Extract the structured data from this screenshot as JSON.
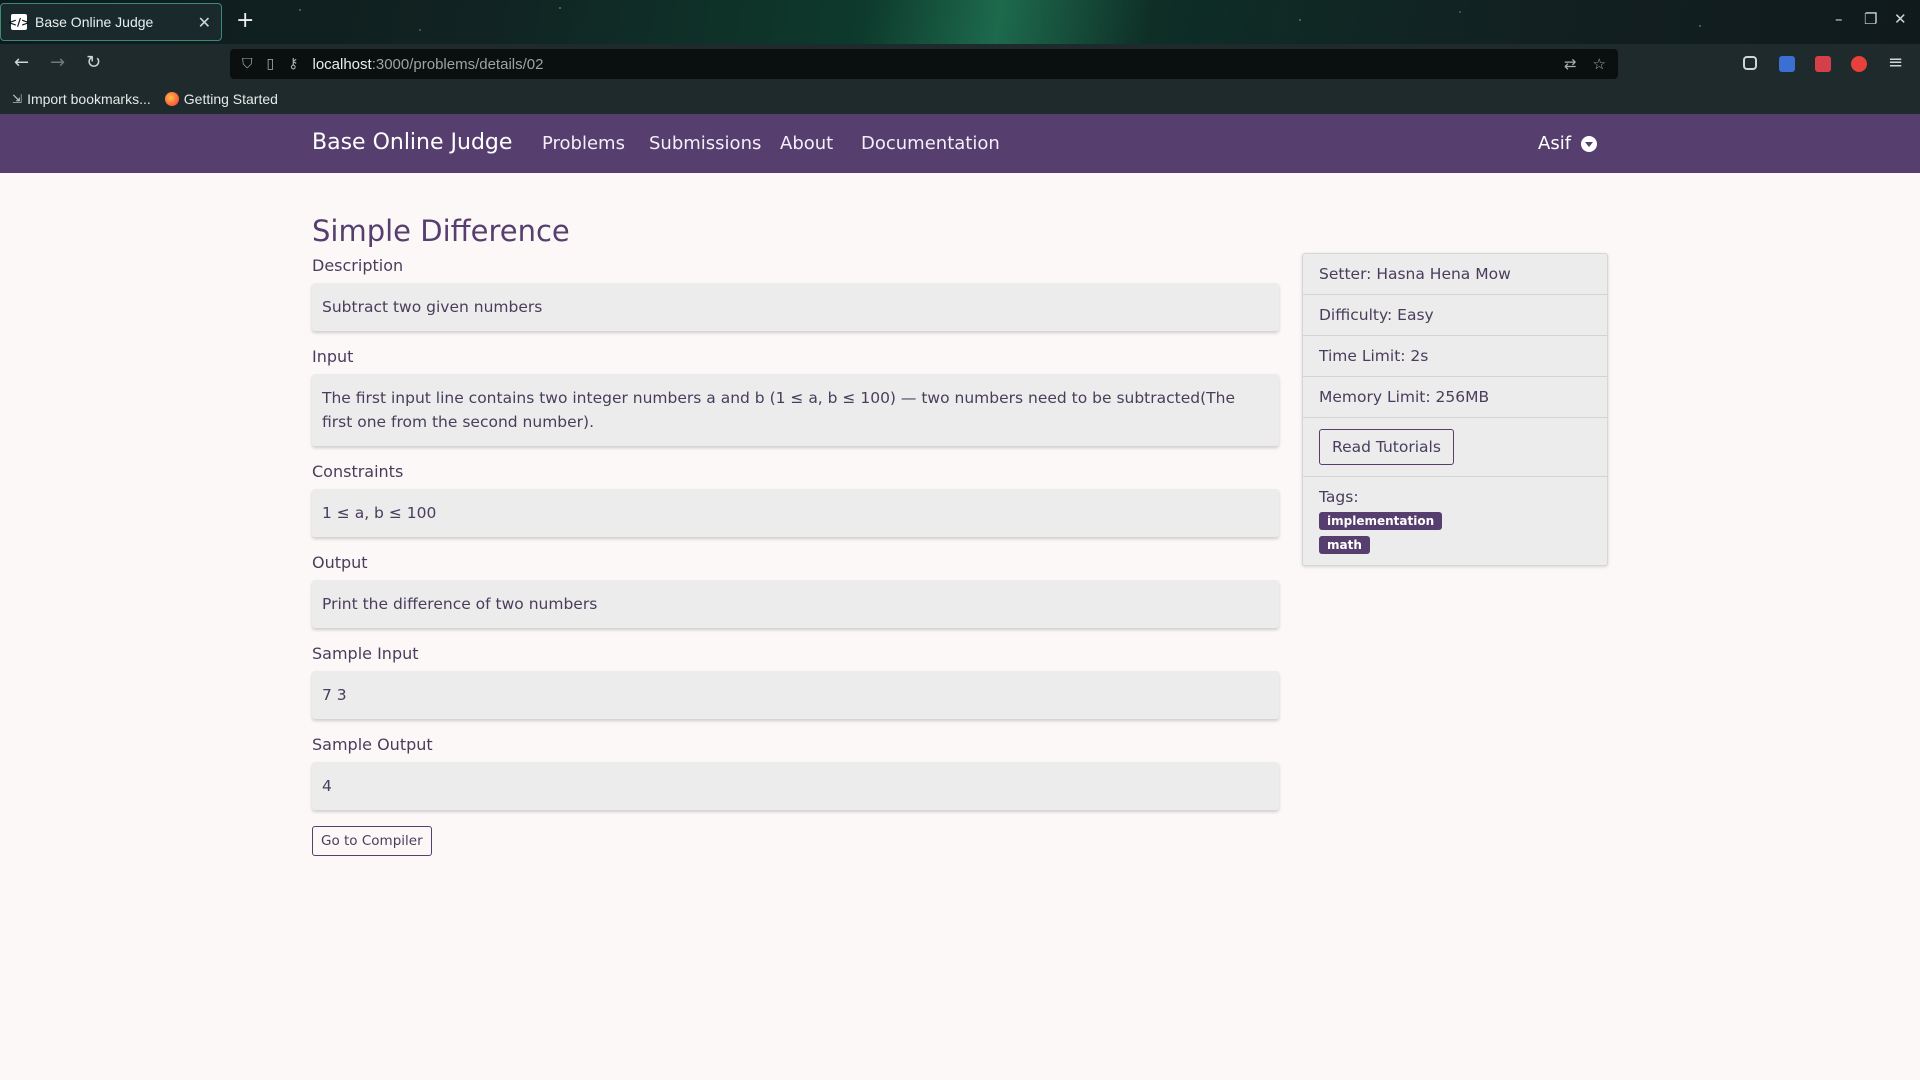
{
  "browser": {
    "tab_title": "Base Online Judge",
    "url_host": "localhost",
    "url_path": ":3000/problems/details/02",
    "bookmarks": [
      "Import bookmarks...",
      "Getting Started"
    ]
  },
  "nav": {
    "brand": "Base Online Judge",
    "links": [
      "Problems",
      "Submissions",
      "About",
      "Documentation"
    ],
    "user": "Asif"
  },
  "problem": {
    "title": "Simple Difference",
    "sections": [
      {
        "label": "Description",
        "text": "Subtract two given numbers"
      },
      {
        "label": "Input",
        "text": "The first input line contains two integer numbers a and b (1 ≤ a, b ≤ 100) — two numbers need to be subtracted(The first one from the second number)."
      },
      {
        "label": "Constraints",
        "text": "1 ≤ a, b ≤ 100"
      },
      {
        "label": "Output",
        "text": "Print the difference of two numbers"
      },
      {
        "label": "Sample Input",
        "text": "7 3"
      },
      {
        "label": "Sample Output",
        "text": "4"
      }
    ],
    "compiler_button": "Go to Compiler"
  },
  "sidebar": {
    "setter": "Setter: Hasna Hena Mow",
    "difficulty": "Difficulty: Easy",
    "time_limit": "Time Limit: 2s",
    "memory_limit": "Memory Limit: 256MB",
    "tutorial_button": "Read Tutorials",
    "tags_label": "Tags:",
    "tags": [
      "implementation",
      "math"
    ]
  },
  "colors": {
    "accent": "#563f6e",
    "background": "#fdf8f8",
    "card": "#ececec"
  }
}
